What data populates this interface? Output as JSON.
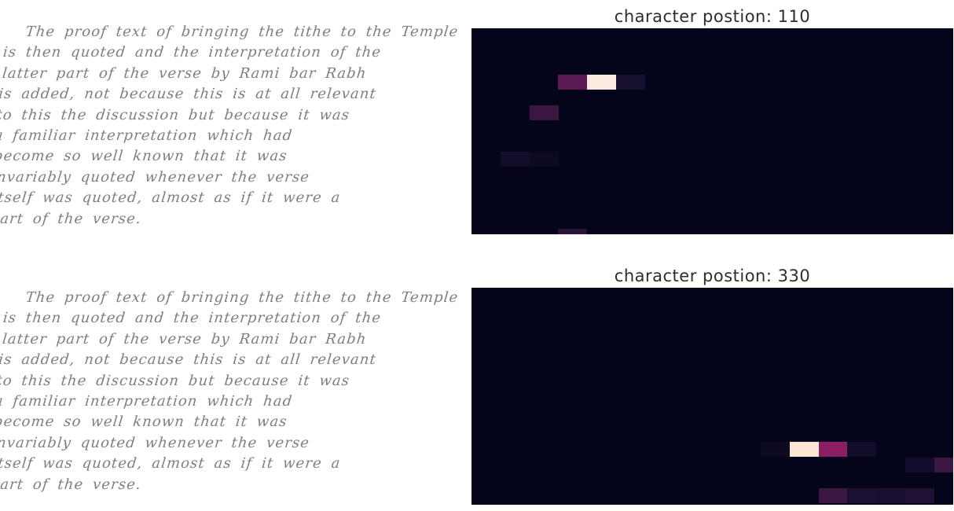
{
  "handwriting_lines": [
    "The proof text of bringing the tithe to the Temple",
    "is then quoted and the interpretation of the",
    "latter part of the verse by Rami bar Rabh",
    "is added, not because this is at all relevant",
    "to this the discussion but because it was",
    "a familiar interpretation which had",
    "become so well known that it was",
    "invariably quoted whenever the verse",
    "itself was quoted, almost as if it were a",
    "part of the verse."
  ],
  "panels": [
    {
      "caption": "character postion: 110",
      "cells": [
        {
          "row": 3,
          "col": 3,
          "color": "#5c1a55"
        },
        {
          "row": 3,
          "col": 4,
          "color": "#fbece1"
        },
        {
          "row": 3,
          "col": 5,
          "color": "#17102e"
        },
        {
          "row": 5,
          "col": 2,
          "color": "#3a1743"
        },
        {
          "row": 8,
          "col": 1,
          "color": "#140d2a"
        },
        {
          "row": 8,
          "col": 2,
          "color": "#0d0a22"
        },
        {
          "row": 13,
          "col": 3,
          "color": "#2b1238"
        }
      ]
    },
    {
      "caption": "character postion: 330",
      "cells": [
        {
          "row": 10,
          "col": 10,
          "color": "#0d0a22"
        },
        {
          "row": 10,
          "col": 11,
          "color": "#fbe6d6"
        },
        {
          "row": 10,
          "col": 12,
          "color": "#8a2063"
        },
        {
          "row": 10,
          "col": 13,
          "color": "#140d2a"
        },
        {
          "row": 11,
          "col": 15,
          "color": "#120c29"
        },
        {
          "row": 11,
          "col": 16,
          "color": "#3a1743"
        },
        {
          "row": 13,
          "col": 12,
          "color": "#3b1744"
        },
        {
          "row": 13,
          "col": 13,
          "color": "#1c1032"
        },
        {
          "row": 13,
          "col": 14,
          "color": "#1a0f30"
        },
        {
          "row": 13,
          "col": 15,
          "color": "#1f1134"
        }
      ]
    }
  ],
  "colors": {
    "heatmap_background": "#04051a",
    "ink": "#7e7e7e"
  }
}
